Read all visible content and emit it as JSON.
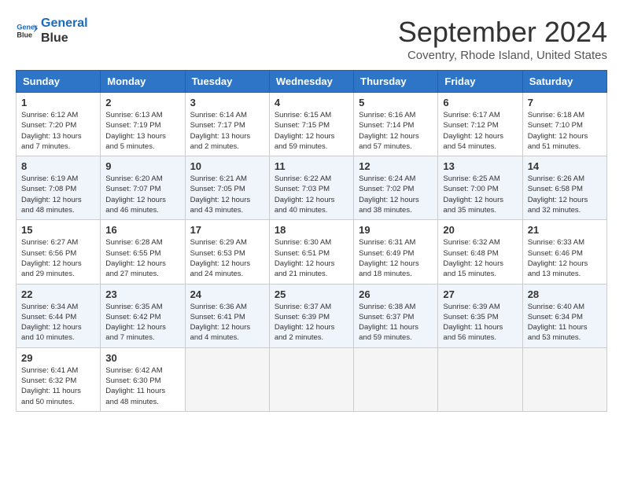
{
  "logo": {
    "line1": "General",
    "line2": "Blue"
  },
  "title": "September 2024",
  "location": "Coventry, Rhode Island, United States",
  "weekdays": [
    "Sunday",
    "Monday",
    "Tuesday",
    "Wednesday",
    "Thursday",
    "Friday",
    "Saturday"
  ],
  "weeks": [
    [
      {
        "day": "1",
        "sunrise": "6:12 AM",
        "sunset": "7:20 PM",
        "daylight": "13 hours and 7 minutes."
      },
      {
        "day": "2",
        "sunrise": "6:13 AM",
        "sunset": "7:19 PM",
        "daylight": "13 hours and 5 minutes."
      },
      {
        "day": "3",
        "sunrise": "6:14 AM",
        "sunset": "7:17 PM",
        "daylight": "13 hours and 2 minutes."
      },
      {
        "day": "4",
        "sunrise": "6:15 AM",
        "sunset": "7:15 PM",
        "daylight": "12 hours and 59 minutes."
      },
      {
        "day": "5",
        "sunrise": "6:16 AM",
        "sunset": "7:14 PM",
        "daylight": "12 hours and 57 minutes."
      },
      {
        "day": "6",
        "sunrise": "6:17 AM",
        "sunset": "7:12 PM",
        "daylight": "12 hours and 54 minutes."
      },
      {
        "day": "7",
        "sunrise": "6:18 AM",
        "sunset": "7:10 PM",
        "daylight": "12 hours and 51 minutes."
      }
    ],
    [
      {
        "day": "8",
        "sunrise": "6:19 AM",
        "sunset": "7:08 PM",
        "daylight": "12 hours and 48 minutes."
      },
      {
        "day": "9",
        "sunrise": "6:20 AM",
        "sunset": "7:07 PM",
        "daylight": "12 hours and 46 minutes."
      },
      {
        "day": "10",
        "sunrise": "6:21 AM",
        "sunset": "7:05 PM",
        "daylight": "12 hours and 43 minutes."
      },
      {
        "day": "11",
        "sunrise": "6:22 AM",
        "sunset": "7:03 PM",
        "daylight": "12 hours and 40 minutes."
      },
      {
        "day": "12",
        "sunrise": "6:24 AM",
        "sunset": "7:02 PM",
        "daylight": "12 hours and 38 minutes."
      },
      {
        "day": "13",
        "sunrise": "6:25 AM",
        "sunset": "7:00 PM",
        "daylight": "12 hours and 35 minutes."
      },
      {
        "day": "14",
        "sunrise": "6:26 AM",
        "sunset": "6:58 PM",
        "daylight": "12 hours and 32 minutes."
      }
    ],
    [
      {
        "day": "15",
        "sunrise": "6:27 AM",
        "sunset": "6:56 PM",
        "daylight": "12 hours and 29 minutes."
      },
      {
        "day": "16",
        "sunrise": "6:28 AM",
        "sunset": "6:55 PM",
        "daylight": "12 hours and 27 minutes."
      },
      {
        "day": "17",
        "sunrise": "6:29 AM",
        "sunset": "6:53 PM",
        "daylight": "12 hours and 24 minutes."
      },
      {
        "day": "18",
        "sunrise": "6:30 AM",
        "sunset": "6:51 PM",
        "daylight": "12 hours and 21 minutes."
      },
      {
        "day": "19",
        "sunrise": "6:31 AM",
        "sunset": "6:49 PM",
        "daylight": "12 hours and 18 minutes."
      },
      {
        "day": "20",
        "sunrise": "6:32 AM",
        "sunset": "6:48 PM",
        "daylight": "12 hours and 15 minutes."
      },
      {
        "day": "21",
        "sunrise": "6:33 AM",
        "sunset": "6:46 PM",
        "daylight": "12 hours and 13 minutes."
      }
    ],
    [
      {
        "day": "22",
        "sunrise": "6:34 AM",
        "sunset": "6:44 PM",
        "daylight": "12 hours and 10 minutes."
      },
      {
        "day": "23",
        "sunrise": "6:35 AM",
        "sunset": "6:42 PM",
        "daylight": "12 hours and 7 minutes."
      },
      {
        "day": "24",
        "sunrise": "6:36 AM",
        "sunset": "6:41 PM",
        "daylight": "12 hours and 4 minutes."
      },
      {
        "day": "25",
        "sunrise": "6:37 AM",
        "sunset": "6:39 PM",
        "daylight": "12 hours and 2 minutes."
      },
      {
        "day": "26",
        "sunrise": "6:38 AM",
        "sunset": "6:37 PM",
        "daylight": "11 hours and 59 minutes."
      },
      {
        "day": "27",
        "sunrise": "6:39 AM",
        "sunset": "6:35 PM",
        "daylight": "11 hours and 56 minutes."
      },
      {
        "day": "28",
        "sunrise": "6:40 AM",
        "sunset": "6:34 PM",
        "daylight": "11 hours and 53 minutes."
      }
    ],
    [
      {
        "day": "29",
        "sunrise": "6:41 AM",
        "sunset": "6:32 PM",
        "daylight": "11 hours and 50 minutes."
      },
      {
        "day": "30",
        "sunrise": "6:42 AM",
        "sunset": "6:30 PM",
        "daylight": "11 hours and 48 minutes."
      },
      null,
      null,
      null,
      null,
      null
    ]
  ]
}
